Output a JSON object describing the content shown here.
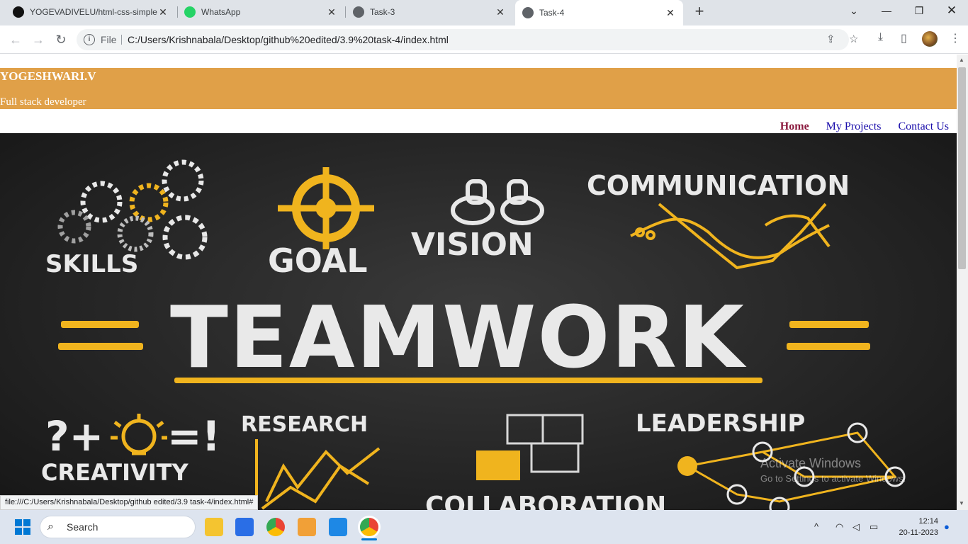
{
  "browser": {
    "tabs": [
      {
        "title": "YOGEVADIVELU/html-css-simple",
        "favicon": "github-icon"
      },
      {
        "title": "WhatsApp",
        "favicon": "whatsapp-icon"
      },
      {
        "title": "Task-3",
        "favicon": "globe-icon"
      },
      {
        "title": "Task-4",
        "favicon": "globe-icon",
        "active": true
      }
    ],
    "address": {
      "scheme_label": "File",
      "url": "C:/Users/Krishnabala/Desktop/github%20edited/3.9%20task-4/index.html"
    },
    "status_url": "file:///C:/Users/Krishnabala/Desktop/github edited/3.9 task-4/index.html#"
  },
  "page": {
    "header": {
      "name": "YOGESHWARI.V",
      "role": "Full stack developer"
    },
    "nav": [
      {
        "label": "Home",
        "current": true
      },
      {
        "label": "My Projects"
      },
      {
        "label": "Contact Us"
      }
    ],
    "hero": {
      "image_words": [
        "SKILLS",
        "GOAL",
        "VISION",
        "COMMUNICATION",
        "TEAMWORK",
        "?+",
        "=!",
        "CREATIVITY",
        "RESEARCH",
        "LEADERSHIP",
        "COLLABORATION"
      ]
    }
  },
  "os": {
    "activation": {
      "title": "Activate Windows",
      "subtitle": "Go to Settings to activate Windows."
    },
    "taskbar": {
      "search_label": "Search",
      "time": "12:14",
      "date": "20-11-2023"
    }
  },
  "colors": {
    "header_bg": "#e0a048",
    "accent_yellow": "#f0b41e",
    "nav_current": "#8b1a3e",
    "nav_link": "#1a0dab"
  }
}
